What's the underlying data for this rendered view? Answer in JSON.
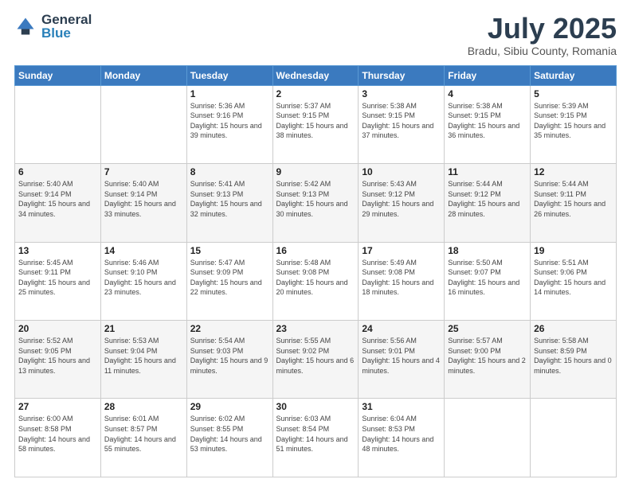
{
  "header": {
    "logo_general": "General",
    "logo_blue": "Blue",
    "month_title": "July 2025",
    "location": "Bradu, Sibiu County, Romania"
  },
  "weekdays": [
    "Sunday",
    "Monday",
    "Tuesday",
    "Wednesday",
    "Thursday",
    "Friday",
    "Saturday"
  ],
  "weeks": [
    [
      {
        "day": "",
        "sunrise": "",
        "sunset": "",
        "daylight": ""
      },
      {
        "day": "",
        "sunrise": "",
        "sunset": "",
        "daylight": ""
      },
      {
        "day": "1",
        "sunrise": "Sunrise: 5:36 AM",
        "sunset": "Sunset: 9:16 PM",
        "daylight": "Daylight: 15 hours and 39 minutes."
      },
      {
        "day": "2",
        "sunrise": "Sunrise: 5:37 AM",
        "sunset": "Sunset: 9:15 PM",
        "daylight": "Daylight: 15 hours and 38 minutes."
      },
      {
        "day": "3",
        "sunrise": "Sunrise: 5:38 AM",
        "sunset": "Sunset: 9:15 PM",
        "daylight": "Daylight: 15 hours and 37 minutes."
      },
      {
        "day": "4",
        "sunrise": "Sunrise: 5:38 AM",
        "sunset": "Sunset: 9:15 PM",
        "daylight": "Daylight: 15 hours and 36 minutes."
      },
      {
        "day": "5",
        "sunrise": "Sunrise: 5:39 AM",
        "sunset": "Sunset: 9:15 PM",
        "daylight": "Daylight: 15 hours and 35 minutes."
      }
    ],
    [
      {
        "day": "6",
        "sunrise": "Sunrise: 5:40 AM",
        "sunset": "Sunset: 9:14 PM",
        "daylight": "Daylight: 15 hours and 34 minutes."
      },
      {
        "day": "7",
        "sunrise": "Sunrise: 5:40 AM",
        "sunset": "Sunset: 9:14 PM",
        "daylight": "Daylight: 15 hours and 33 minutes."
      },
      {
        "day": "8",
        "sunrise": "Sunrise: 5:41 AM",
        "sunset": "Sunset: 9:13 PM",
        "daylight": "Daylight: 15 hours and 32 minutes."
      },
      {
        "day": "9",
        "sunrise": "Sunrise: 5:42 AM",
        "sunset": "Sunset: 9:13 PM",
        "daylight": "Daylight: 15 hours and 30 minutes."
      },
      {
        "day": "10",
        "sunrise": "Sunrise: 5:43 AM",
        "sunset": "Sunset: 9:12 PM",
        "daylight": "Daylight: 15 hours and 29 minutes."
      },
      {
        "day": "11",
        "sunrise": "Sunrise: 5:44 AM",
        "sunset": "Sunset: 9:12 PM",
        "daylight": "Daylight: 15 hours and 28 minutes."
      },
      {
        "day": "12",
        "sunrise": "Sunrise: 5:44 AM",
        "sunset": "Sunset: 9:11 PM",
        "daylight": "Daylight: 15 hours and 26 minutes."
      }
    ],
    [
      {
        "day": "13",
        "sunrise": "Sunrise: 5:45 AM",
        "sunset": "Sunset: 9:11 PM",
        "daylight": "Daylight: 15 hours and 25 minutes."
      },
      {
        "day": "14",
        "sunrise": "Sunrise: 5:46 AM",
        "sunset": "Sunset: 9:10 PM",
        "daylight": "Daylight: 15 hours and 23 minutes."
      },
      {
        "day": "15",
        "sunrise": "Sunrise: 5:47 AM",
        "sunset": "Sunset: 9:09 PM",
        "daylight": "Daylight: 15 hours and 22 minutes."
      },
      {
        "day": "16",
        "sunrise": "Sunrise: 5:48 AM",
        "sunset": "Sunset: 9:08 PM",
        "daylight": "Daylight: 15 hours and 20 minutes."
      },
      {
        "day": "17",
        "sunrise": "Sunrise: 5:49 AM",
        "sunset": "Sunset: 9:08 PM",
        "daylight": "Daylight: 15 hours and 18 minutes."
      },
      {
        "day": "18",
        "sunrise": "Sunrise: 5:50 AM",
        "sunset": "Sunset: 9:07 PM",
        "daylight": "Daylight: 15 hours and 16 minutes."
      },
      {
        "day": "19",
        "sunrise": "Sunrise: 5:51 AM",
        "sunset": "Sunset: 9:06 PM",
        "daylight": "Daylight: 15 hours and 14 minutes."
      }
    ],
    [
      {
        "day": "20",
        "sunrise": "Sunrise: 5:52 AM",
        "sunset": "Sunset: 9:05 PM",
        "daylight": "Daylight: 15 hours and 13 minutes."
      },
      {
        "day": "21",
        "sunrise": "Sunrise: 5:53 AM",
        "sunset": "Sunset: 9:04 PM",
        "daylight": "Daylight: 15 hours and 11 minutes."
      },
      {
        "day": "22",
        "sunrise": "Sunrise: 5:54 AM",
        "sunset": "Sunset: 9:03 PM",
        "daylight": "Daylight: 15 hours and 9 minutes."
      },
      {
        "day": "23",
        "sunrise": "Sunrise: 5:55 AM",
        "sunset": "Sunset: 9:02 PM",
        "daylight": "Daylight: 15 hours and 6 minutes."
      },
      {
        "day": "24",
        "sunrise": "Sunrise: 5:56 AM",
        "sunset": "Sunset: 9:01 PM",
        "daylight": "Daylight: 15 hours and 4 minutes."
      },
      {
        "day": "25",
        "sunrise": "Sunrise: 5:57 AM",
        "sunset": "Sunset: 9:00 PM",
        "daylight": "Daylight: 15 hours and 2 minutes."
      },
      {
        "day": "26",
        "sunrise": "Sunrise: 5:58 AM",
        "sunset": "Sunset: 8:59 PM",
        "daylight": "Daylight: 15 hours and 0 minutes."
      }
    ],
    [
      {
        "day": "27",
        "sunrise": "Sunrise: 6:00 AM",
        "sunset": "Sunset: 8:58 PM",
        "daylight": "Daylight: 14 hours and 58 minutes."
      },
      {
        "day": "28",
        "sunrise": "Sunrise: 6:01 AM",
        "sunset": "Sunset: 8:57 PM",
        "daylight": "Daylight: 14 hours and 55 minutes."
      },
      {
        "day": "29",
        "sunrise": "Sunrise: 6:02 AM",
        "sunset": "Sunset: 8:55 PM",
        "daylight": "Daylight: 14 hours and 53 minutes."
      },
      {
        "day": "30",
        "sunrise": "Sunrise: 6:03 AM",
        "sunset": "Sunset: 8:54 PM",
        "daylight": "Daylight: 14 hours and 51 minutes."
      },
      {
        "day": "31",
        "sunrise": "Sunrise: 6:04 AM",
        "sunset": "Sunset: 8:53 PM",
        "daylight": "Daylight: 14 hours and 48 minutes."
      },
      {
        "day": "",
        "sunrise": "",
        "sunset": "",
        "daylight": ""
      },
      {
        "day": "",
        "sunrise": "",
        "sunset": "",
        "daylight": ""
      }
    ]
  ]
}
